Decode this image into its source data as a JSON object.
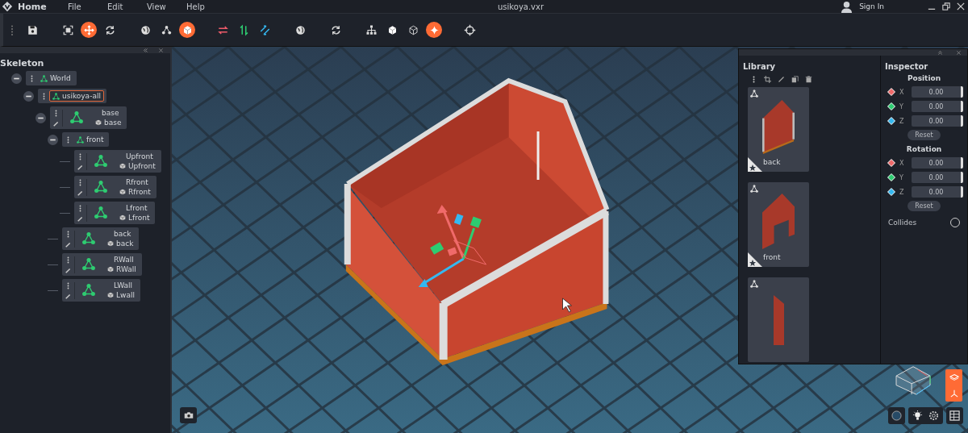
{
  "menu_bar": {
    "app_label": "Home",
    "items": [
      "File",
      "Edit",
      "View",
      "Help"
    ],
    "file_title": "usikoya.vxr",
    "sign_in": "Sign In"
  },
  "toolbar": {
    "groups": [
      [
        {
          "kind": "save",
          "active": false
        }
      ],
      [
        {
          "kind": "fit",
          "active": false
        },
        {
          "kind": "move",
          "active": true
        },
        {
          "kind": "rotate",
          "active": false
        }
      ],
      [
        {
          "kind": "globe",
          "active": false
        },
        {
          "kind": "nodes",
          "active": false
        },
        {
          "kind": "cube",
          "active": true
        }
      ],
      [
        {
          "kind": "swap",
          "active": false
        },
        {
          "kind": "updown",
          "active": false
        },
        {
          "kind": "diagonal",
          "active": false
        }
      ],
      [
        {
          "kind": "globe",
          "active": false
        }
      ],
      [
        {
          "kind": "rotate",
          "active": false
        }
      ],
      [
        {
          "kind": "tree",
          "active": false
        },
        {
          "kind": "cube",
          "active": false
        },
        {
          "kind": "cube-outline",
          "active": false
        },
        {
          "kind": "sparkle",
          "active": true
        }
      ],
      [
        {
          "kind": "crosshair",
          "active": false
        }
      ]
    ]
  },
  "skeleton": {
    "title": "Skeleton",
    "nodes": [
      {
        "kind": "group",
        "label": "World",
        "selected": false,
        "expanded": true,
        "children": [
          {
            "kind": "group",
            "label": "usikoya-all",
            "selected": true,
            "expanded": true,
            "children": [
              {
                "kind": "mesh",
                "label": "base",
                "mesh": "base",
                "selected": false,
                "expanded": true,
                "children": [
                  {
                    "kind": "group",
                    "label": "front",
                    "selected": false,
                    "expanded": true,
                    "children": [
                      {
                        "kind": "mesh",
                        "label": "Upfront",
                        "mesh": "Upfront",
                        "selected": false
                      },
                      {
                        "kind": "mesh",
                        "label": "Rfront",
                        "mesh": "Rfront",
                        "selected": false
                      },
                      {
                        "kind": "mesh",
                        "label": "Lfront",
                        "mesh": "Lfront",
                        "selected": false
                      }
                    ]
                  },
                  {
                    "kind": "mesh",
                    "label": "back",
                    "mesh": "back",
                    "selected": false
                  },
                  {
                    "kind": "mesh",
                    "label": "RWall",
                    "mesh": "RWall",
                    "selected": false
                  },
                  {
                    "kind": "mesh",
                    "label": "LWall",
                    "mesh": "Lwall",
                    "selected": false
                  }
                ]
              }
            ]
          }
        ]
      }
    ]
  },
  "library": {
    "title": "Library",
    "items": [
      {
        "label": "back",
        "kind": "gable",
        "favorite": true
      },
      {
        "label": "front",
        "kind": "door",
        "favorite": true
      },
      {
        "kind": "plank",
        "favorite": false
      }
    ]
  },
  "inspector": {
    "title": "Inspector",
    "sections": [
      {
        "title": "Position",
        "rows": [
          {
            "axis": "X",
            "value": "0.00",
            "color": "#f06a6a"
          },
          {
            "axis": "Y",
            "value": "0.00",
            "color": "#2ecc71"
          },
          {
            "axis": "Z",
            "value": "0.00",
            "color": "#35b8f0"
          }
        ],
        "button": "Reset"
      },
      {
        "title": "Rotation",
        "rows": [
          {
            "axis": "X",
            "value": "0.00",
            "color": "#f06a6a"
          },
          {
            "axis": "Y",
            "value": "0.00",
            "color": "#2ecc71"
          },
          {
            "axis": "Z",
            "value": "0.00",
            "color": "#35b8f0"
          }
        ],
        "button": "Reset"
      }
    ],
    "collides": {
      "label": "Collides",
      "checked": false
    }
  }
}
